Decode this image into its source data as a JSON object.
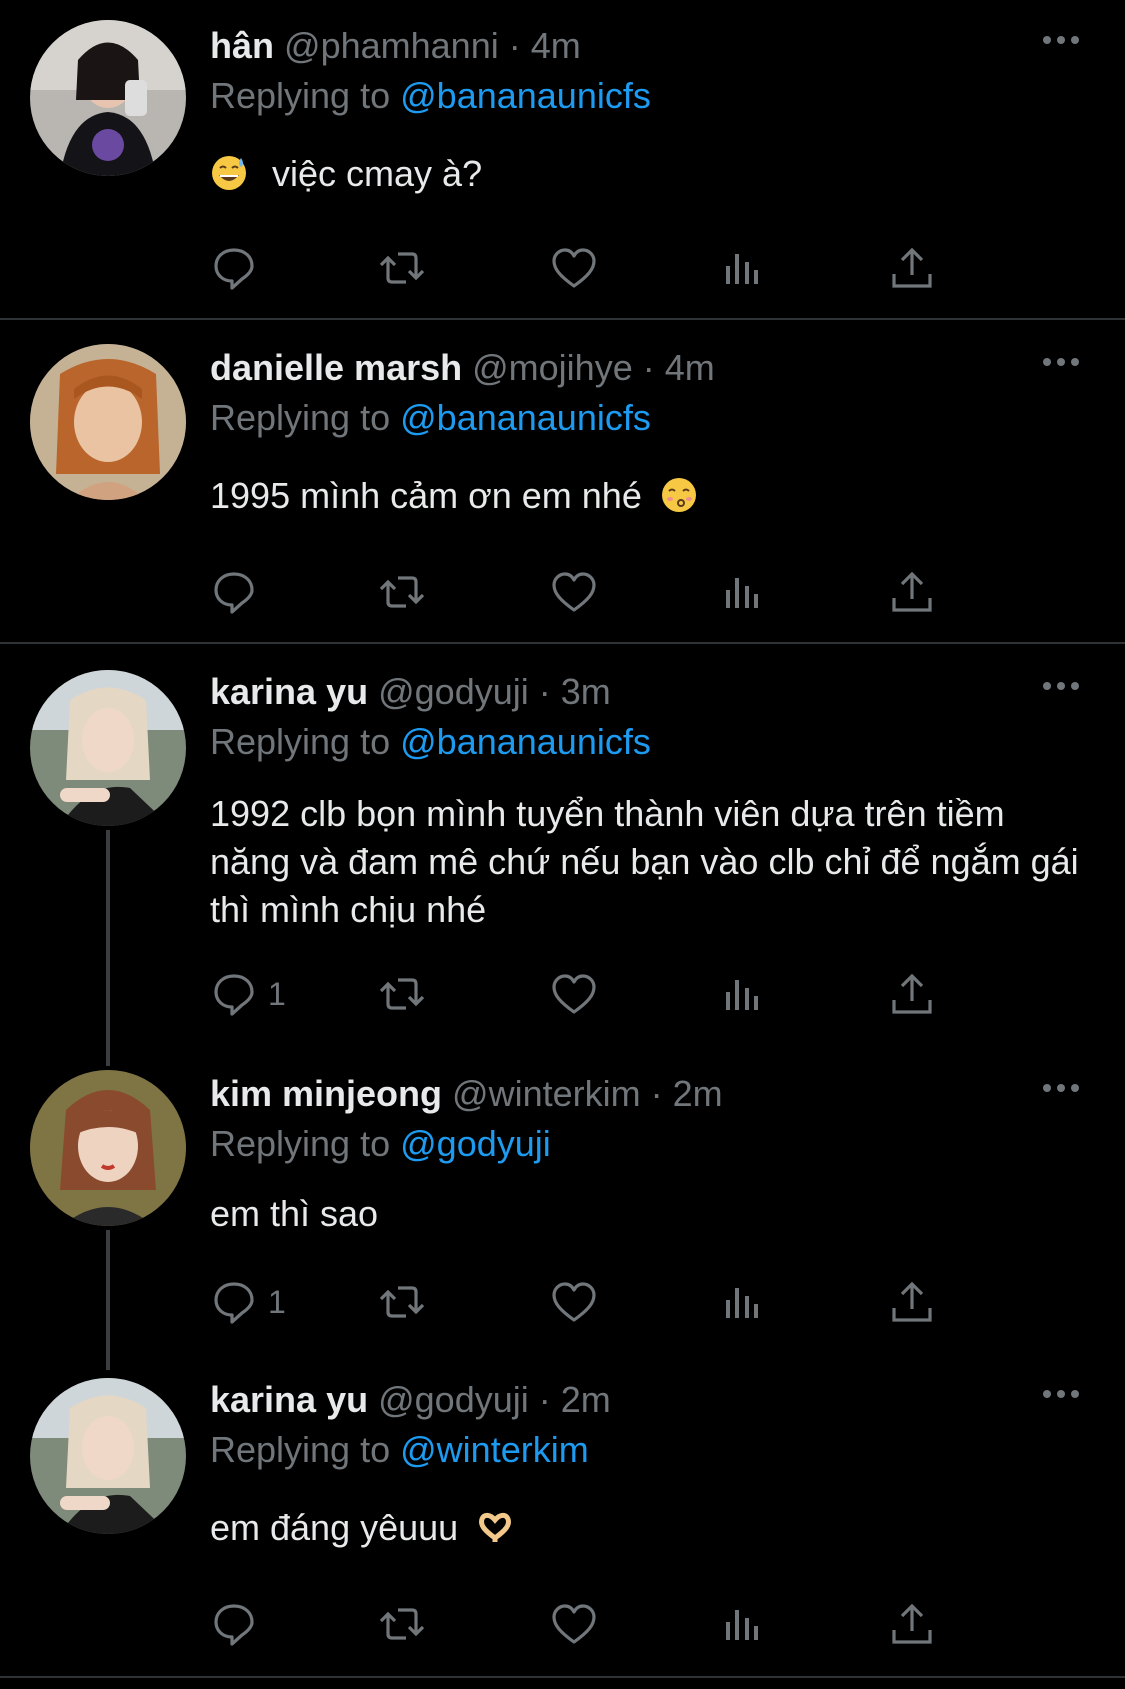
{
  "tweets": [
    {
      "name": "hân",
      "handle": "@phamhanni",
      "sep": "·",
      "time": "4m",
      "replying_prefix": "Replying to",
      "replying_to": "@bananaunicfs",
      "text": "việc cmay à?",
      "emoji": "sweat-smile-emoji",
      "reply_count": ""
    },
    {
      "name": "danielle marsh",
      "handle": "@mojihye",
      "sep": "·",
      "time": "4m",
      "replying_prefix": "Replying to",
      "replying_to": "@bananaunicfs",
      "text": "1995 mình cảm ơn em nhé",
      "emoji": "kissing-emoji",
      "reply_count": ""
    },
    {
      "name": "karina yu",
      "handle": "@godyuji",
      "sep": "·",
      "time": "3m",
      "replying_prefix": "Replying to",
      "replying_to": "@bananaunicfs",
      "text": "1992 clb bọn mình tuyển thành viên dựa trên tiềm năng và đam mê chứ nếu bạn vào clb chỉ để ngắm gái thì mình chịu nhé",
      "reply_count": "1"
    },
    {
      "name": "kim minjeong",
      "handle": "@winterkim",
      "sep": "·",
      "time": "2m",
      "replying_prefix": "Replying to",
      "replying_to": "@godyuji",
      "text": "em thì sao",
      "reply_count": "1"
    },
    {
      "name": "karina yu",
      "handle": "@godyuji",
      "sep": "·",
      "time": "2m",
      "replying_prefix": "Replying to",
      "replying_to": "@winterkim",
      "text": "em đáng yêuuu",
      "emoji": "heart-hands-emoji",
      "reply_count": ""
    }
  ],
  "colors": {
    "background": "#000000",
    "text": "#e7e9ea",
    "muted": "#71767b",
    "link": "#1d9bf0",
    "divider": "#2f3336"
  }
}
